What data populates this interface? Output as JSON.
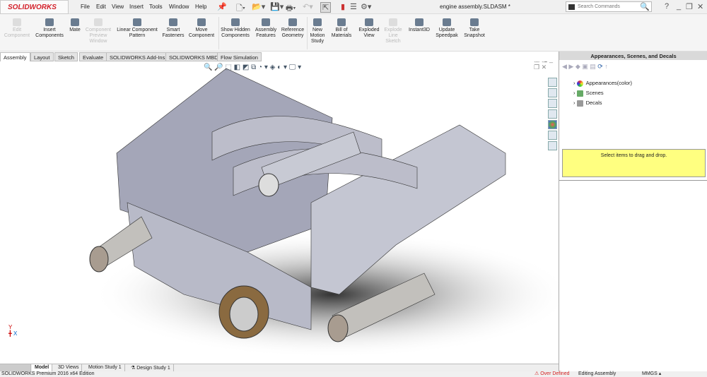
{
  "app": {
    "logo": "SOLIDWORKS",
    "title": "engine assembly.SLDASM *"
  },
  "menu": [
    "File",
    "Edit",
    "View",
    "Insert",
    "Tools",
    "Window",
    "Help"
  ],
  "search": {
    "placeholder": "Search Commands"
  },
  "ribbon": [
    {
      "label": "Edit Component",
      "disabled": true
    },
    {
      "label": "Insert Components",
      "disabled": false
    },
    {
      "label": "Mate",
      "disabled": false
    },
    {
      "label": "Component Preview Window",
      "disabled": true
    },
    {
      "label": "Linear Component Pattern",
      "disabled": false
    },
    {
      "label": "Smart Fasteners",
      "disabled": false
    },
    {
      "label": "Move Component",
      "disabled": false
    },
    {
      "label": "Show Hidden Components",
      "disabled": false
    },
    {
      "label": "Assembly Features",
      "disabled": false
    },
    {
      "label": "Reference Geometry",
      "disabled": false
    },
    {
      "label": "New Motion Study",
      "disabled": false
    },
    {
      "label": "Bill of Materials",
      "disabled": false
    },
    {
      "label": "Exploded View",
      "disabled": false
    },
    {
      "label": "Explode Line Sketch",
      "disabled": true
    },
    {
      "label": "Instant3D",
      "disabled": false
    },
    {
      "label": "Update Speedpak",
      "disabled": false
    },
    {
      "label": "Take Snapshot",
      "disabled": false
    }
  ],
  "tabs": [
    "Assembly",
    "Layout",
    "Sketch",
    "Evaluate",
    "SOLIDWORKS Add-Ins",
    "SOLIDWORKS MBD",
    "Flow Simulation"
  ],
  "panel": {
    "title": "Appearances, Scenes, and Decals",
    "items": [
      "Appearances(color)",
      "Scenes",
      "Decals"
    ],
    "drop_hint": "Select items to drag and drop."
  },
  "bottom_tabs": [
    "Model",
    "3D Views",
    "Motion Study 1",
    "Design Study 1"
  ],
  "status": {
    "edition": "SOLIDWORKS Premium 2016 x64 Edition",
    "warning": "Over Defined",
    "mode": "Editing Assembly",
    "units": "MMGS"
  },
  "colors": {
    "brand": "#d3202a",
    "warning": "#d32020",
    "drop_zone": "#ffff80",
    "model": "#b4b6c4"
  }
}
